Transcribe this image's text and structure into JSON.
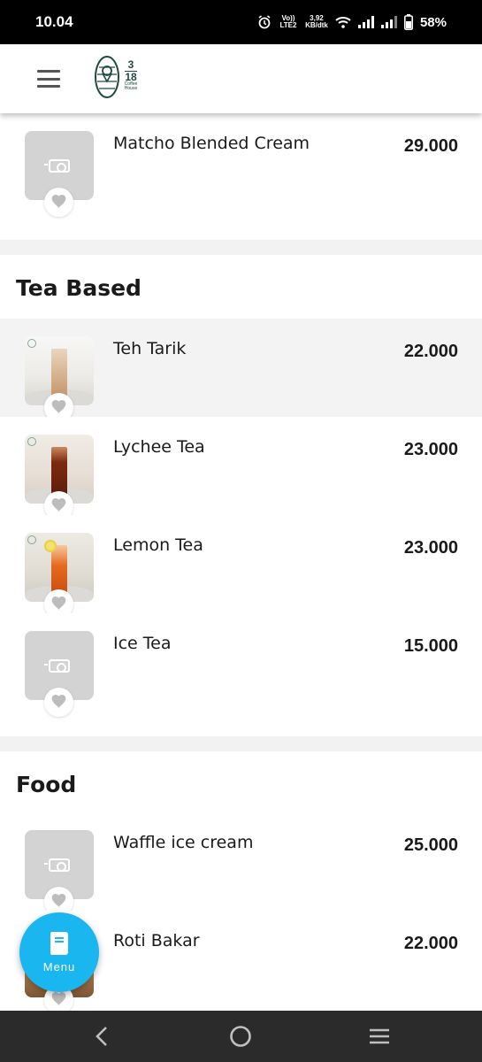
{
  "status_bar": {
    "time": "10.04",
    "carrier_small": "Vo)) LTE2",
    "speed": "3,92 KB/dtk",
    "battery": "58%"
  },
  "header": {
    "logo": {
      "line1": "3",
      "line2": "18",
      "line3": "Coffee House"
    }
  },
  "sections": [
    {
      "title": "",
      "items": [
        {
          "name": "Matcho Blended Cream",
          "price": "29.000",
          "image": "placeholder"
        }
      ]
    },
    {
      "title": "Tea Based",
      "items": [
        {
          "name": "Teh Tarik",
          "price": "22.000",
          "image": "milk-tea-photo"
        },
        {
          "name": "Lychee Tea",
          "price": "23.000",
          "image": "lychee-tea-photo"
        },
        {
          "name": "Lemon Tea",
          "price": "23.000",
          "image": "lemon-tea-photo"
        },
        {
          "name": "Ice Tea",
          "price": "15.000",
          "image": "placeholder"
        }
      ]
    },
    {
      "title": "Food",
      "items": [
        {
          "name": "Waffle ice cream",
          "price": "25.000",
          "image": "placeholder"
        },
        {
          "name": "Roti Bakar",
          "price": "22.000",
          "image": "toast-photo"
        }
      ]
    }
  ],
  "fab": {
    "label": "Menu",
    "color": "#1ab6f0",
    "icon": "book-icon"
  },
  "nav": {
    "back_icon": "back-icon",
    "home_icon": "home-icon",
    "recents_icon": "recents-icon"
  },
  "colors": {
    "accent": "#1ab6f0",
    "placeholder": "#d3d3d3",
    "divider": "#f2f2f2"
  }
}
